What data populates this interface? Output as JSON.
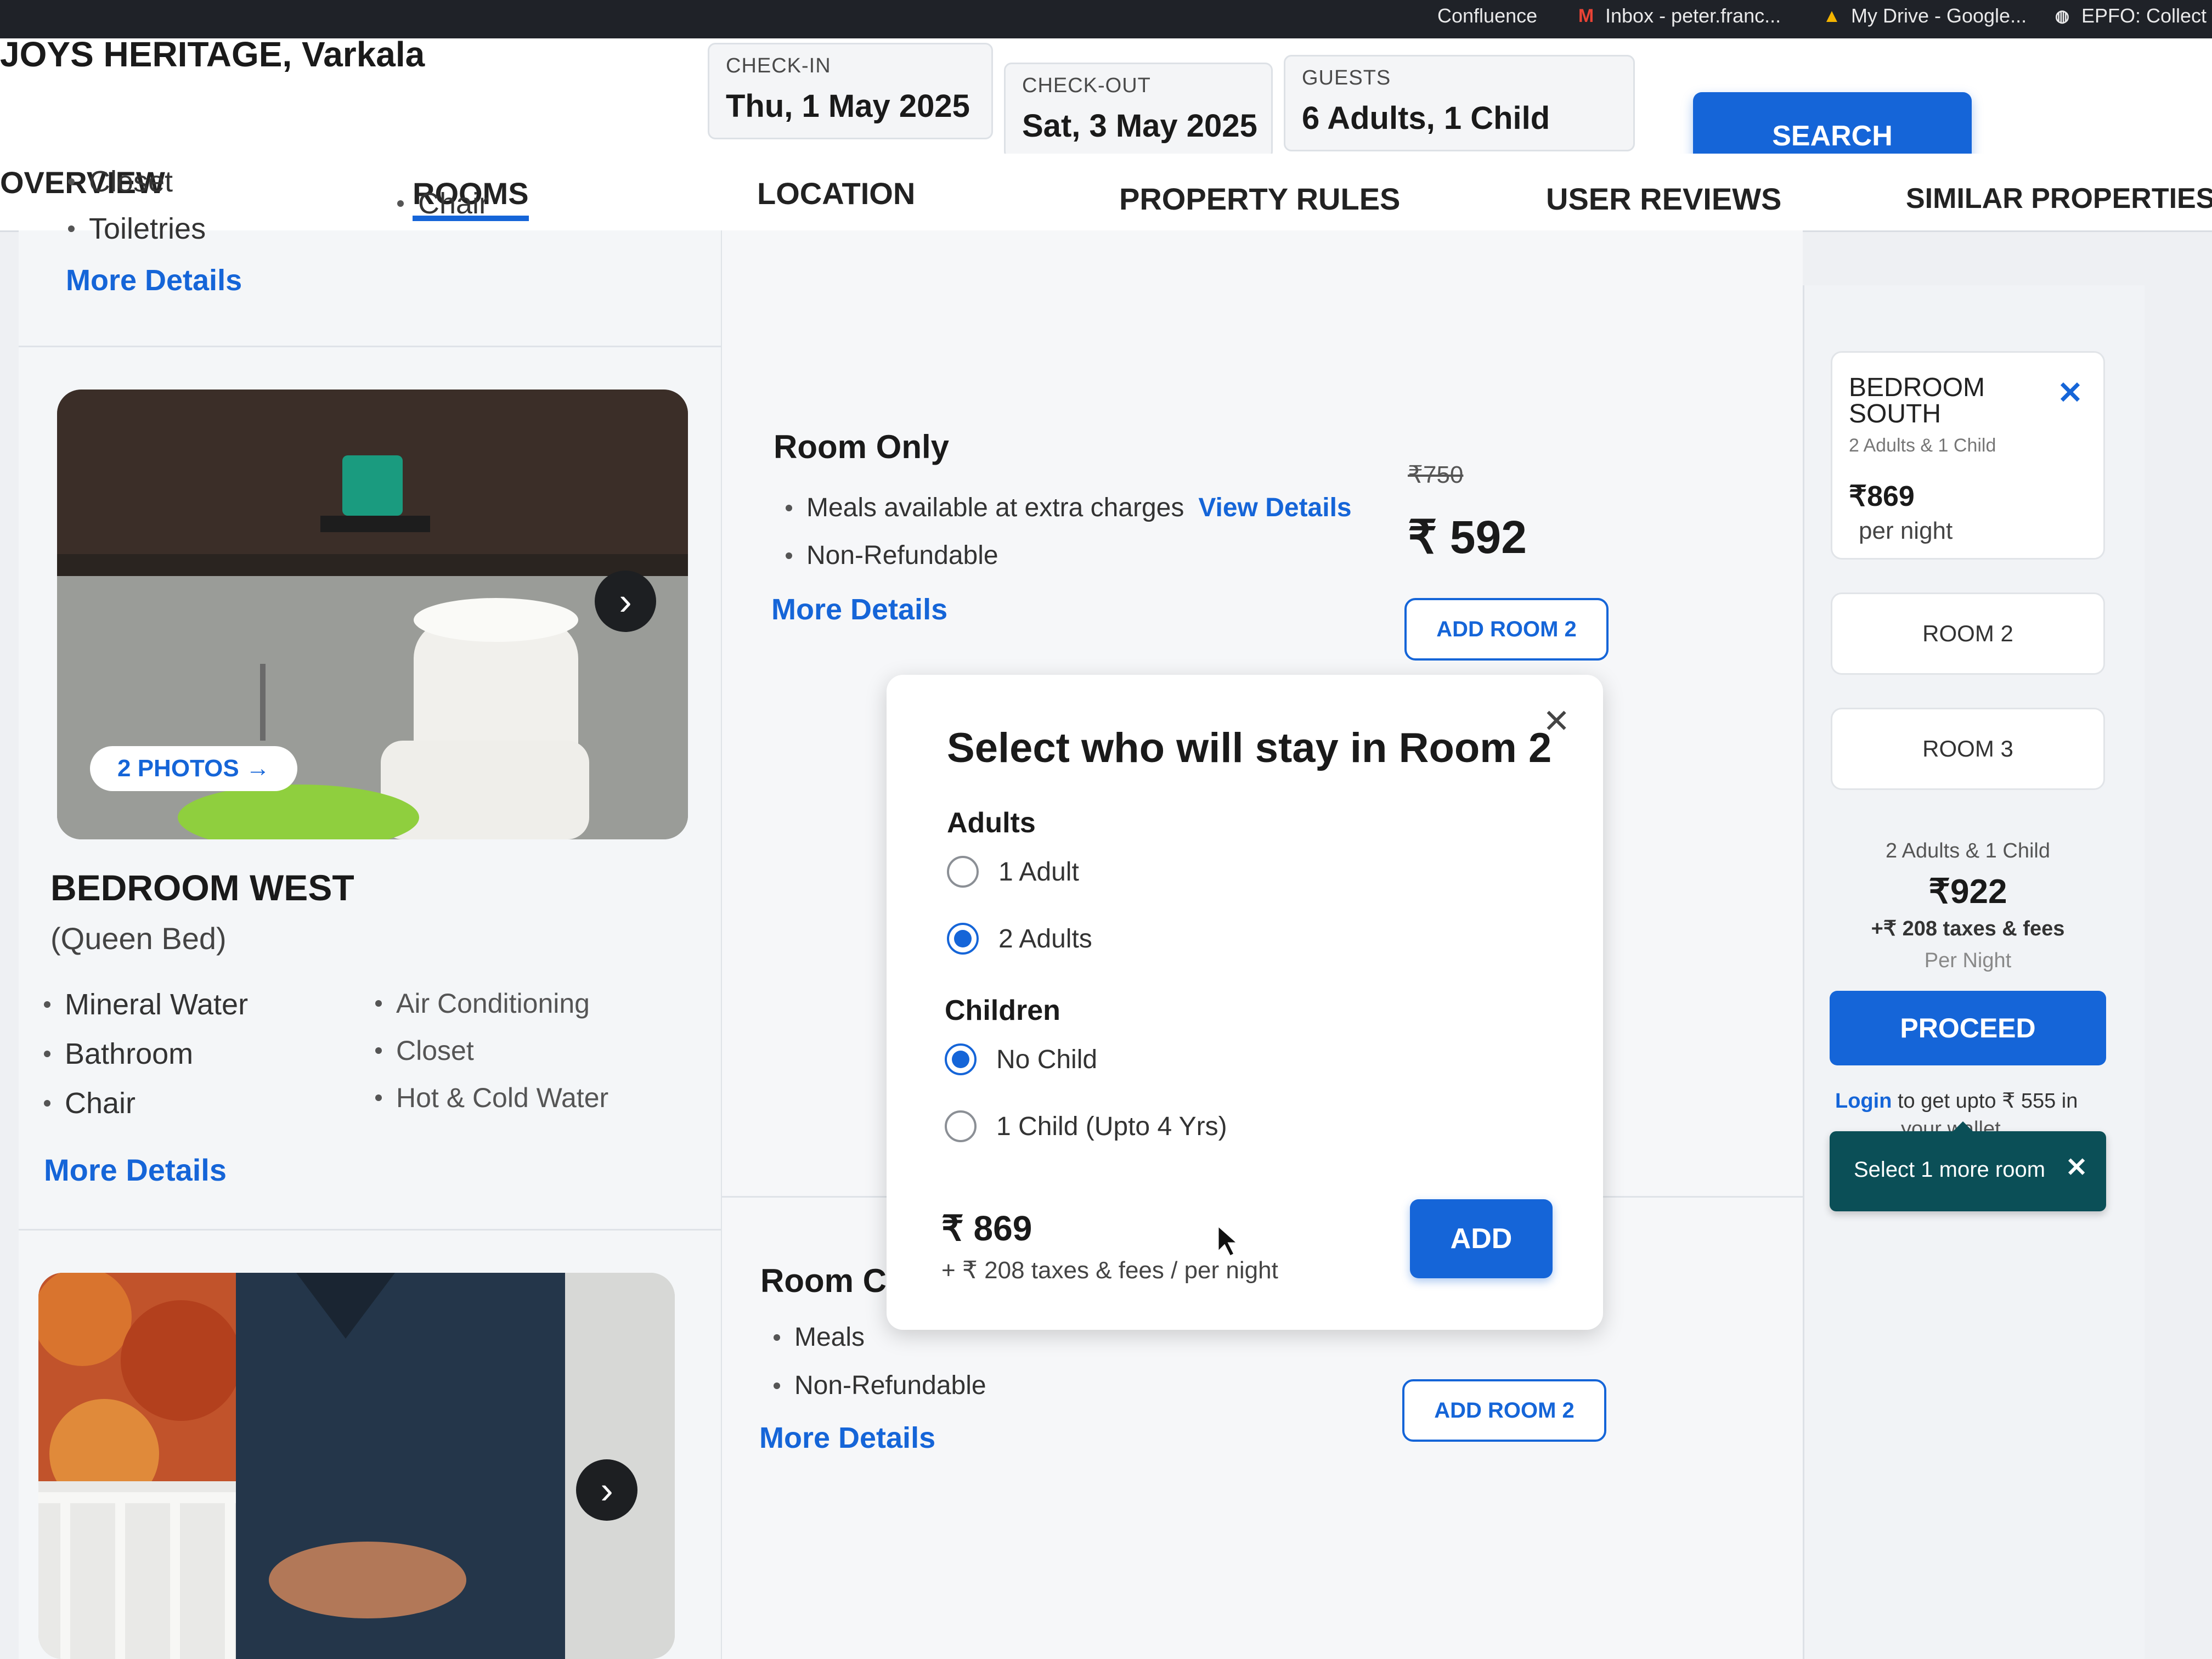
{
  "browser": {
    "bookmarks": [
      {
        "label": "Confluence",
        "icon": "confluence-icon"
      },
      {
        "label": "Inbox - peter.franc...",
        "icon": "gmail-icon"
      },
      {
        "label": "My Drive - Google...",
        "icon": "google-drive-icon"
      },
      {
        "label": "EPFO: Collect C",
        "icon": "globe-icon"
      }
    ]
  },
  "header": {
    "hotel_name": "JOYS HERITAGE, Varkala",
    "checkin": {
      "label": "CHECK-IN",
      "value": "Thu, 1 May 2025"
    },
    "checkout": {
      "label": "CHECK-OUT",
      "value": "Sat, 3 May 2025"
    },
    "guests": {
      "label": "GUESTS",
      "value": "6 Adults, 1 Child"
    },
    "search_label": "SEARCH"
  },
  "tabs": [
    "OVERVIEW",
    "ROOMS",
    "LOCATION",
    "PROPERTY RULES",
    "USER REVIEWS",
    "SIMILAR PROPERTIES"
  ],
  "prev_room": {
    "amenities_col1": [
      "Closet",
      "Toiletries"
    ],
    "amenities_col2": [
      "Chair"
    ],
    "more_details": "More Details"
  },
  "room_west": {
    "photos_label": "2 PHOTOS",
    "name": "BEDROOM WEST",
    "bed": "(Queen Bed)",
    "amenities_col1": [
      "Mineral Water",
      "Bathroom",
      "Chair"
    ],
    "amenities_col2": [
      "Air Conditioning",
      "Closet",
      "Hot & Cold Water"
    ],
    "more_details": "More Details"
  },
  "plan_room_only": {
    "title": "Room Only",
    "features": [
      "Meals available at extra charges",
      "Non-Refundable"
    ],
    "view_details": "View Details",
    "more_details": "More Details",
    "original_price": "₹750",
    "price": "₹ 592",
    "add_button": "ADD ROOM 2"
  },
  "plan_second": {
    "title": "Room C",
    "features": [
      "Meals",
      "Non-Refundable"
    ],
    "more_details": "More Details",
    "add_button": "ADD ROOM 2"
  },
  "popup": {
    "title": "Select who will stay in Room 2",
    "adults_label": "Adults",
    "adult_options": [
      {
        "label": "1 Adult",
        "selected": false
      },
      {
        "label": "2 Adults",
        "selected": true
      }
    ],
    "children_label": "Children",
    "child_options": [
      {
        "label": "No Child",
        "selected": true
      },
      {
        "label": "1 Child (Upto 4 Yrs)",
        "selected": false
      }
    ],
    "price": "₹ 869",
    "taxes": "+ ₹ 208 taxes & fees / per night",
    "add_label": "ADD"
  },
  "cart": {
    "room1": {
      "name_line1": "BEDROOM",
      "name_line2": "SOUTH",
      "guests": "2 Adults & 1 Child",
      "price": "₹869",
      "per": "per night"
    },
    "room2_label": "ROOM 2",
    "room3_label": "ROOM 3",
    "summary_guests": "2 Adults & 1 Child",
    "summary_price": "₹922",
    "summary_taxes": "+₹ 208 taxes & fees",
    "summary_per": "Per Night",
    "proceed_label": "PROCEED",
    "login_link": "Login",
    "login_text": "to get upto ₹ 555 in",
    "login_text2": "your wallet",
    "toast": "Select 1 more room"
  },
  "colors": {
    "accent": "#1565d8",
    "toast": "#0b4f57"
  }
}
